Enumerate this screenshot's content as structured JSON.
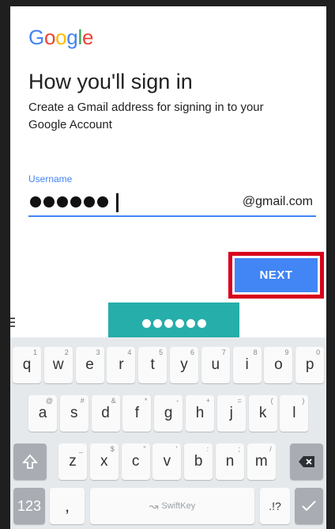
{
  "logo_text": {
    "G": "G",
    "o1": "o",
    "o2": "o",
    "g": "g",
    "l": "l",
    "e": "e"
  },
  "title": "How you'll sign in",
  "subtitle": "Create a Gmail address for signing in to your Google Account",
  "username": {
    "label": "Username",
    "masked_char_count": 6,
    "suffix": "@gmail.com"
  },
  "next_button": "NEXT",
  "keyboard": {
    "row1": [
      {
        "k": "q",
        "h": "1"
      },
      {
        "k": "w",
        "h": "2"
      },
      {
        "k": "e",
        "h": "3"
      },
      {
        "k": "r",
        "h": "4"
      },
      {
        "k": "t",
        "h": "5"
      },
      {
        "k": "y",
        "h": "6"
      },
      {
        "k": "u",
        "h": "7"
      },
      {
        "k": "i",
        "h": "8"
      },
      {
        "k": "o",
        "h": "9"
      },
      {
        "k": "p",
        "h": "0"
      }
    ],
    "row2": [
      {
        "k": "a",
        "h": "@"
      },
      {
        "k": "s",
        "h": "#"
      },
      {
        "k": "d",
        "h": "&"
      },
      {
        "k": "f",
        "h": "*"
      },
      {
        "k": "g",
        "h": "-"
      },
      {
        "k": "h",
        "h": "+"
      },
      {
        "k": "j",
        "h": "="
      },
      {
        "k": "k",
        "h": "("
      },
      {
        "k": "l",
        "h": ")"
      }
    ],
    "row3": [
      {
        "k": "z",
        "h": "_"
      },
      {
        "k": "x",
        "h": "$"
      },
      {
        "k": "c",
        "h": "\""
      },
      {
        "k": "v",
        "h": "'"
      },
      {
        "k": "b",
        "h": ":"
      },
      {
        "k": "n",
        "h": ";"
      },
      {
        "k": "m",
        "h": "/"
      }
    ],
    "numbers_key": "123",
    "comma_key": ",",
    "space_label": "SwiftKey",
    "punct_key": ".!?",
    "shift_icon": "shift-arrow-icon",
    "backspace_icon": "backspace-icon",
    "enter_icon": "checkmark-icon"
  }
}
